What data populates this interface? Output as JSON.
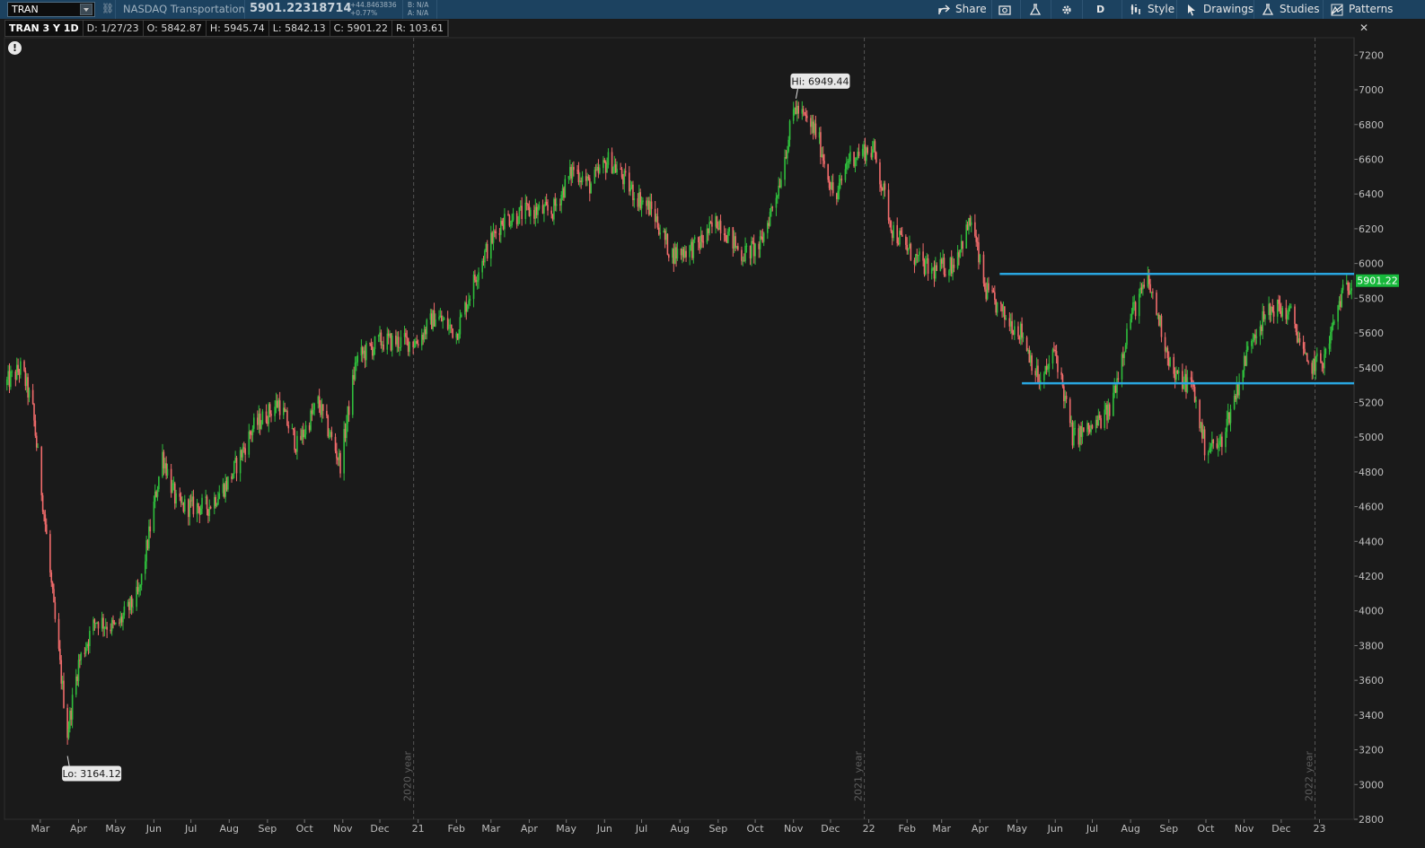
{
  "toolbar": {
    "symbol_value": "TRAN",
    "instrument_name": "NASDAQ Transportation",
    "last_price": "5901.22318714",
    "change_abs": "+44.8463836",
    "change_pct": "+0.77%",
    "bid": "B: N/A",
    "ask": "A: N/A",
    "share_label": "Share",
    "aggregation_label": "D",
    "style_label": "Style",
    "drawings_label": "Drawings",
    "studies_label": "Studies",
    "patterns_label": "Patterns",
    "icons": [
      "link-icon",
      "share-icon",
      "snapshot-icon",
      "flask-icon",
      "gear-icon",
      "style-icon",
      "cursor-icon",
      "studies-icon",
      "patterns-icon",
      "alert-icon"
    ]
  },
  "ohlc": {
    "title": "TRAN 3 Y 1D",
    "date": "D: 1/27/23",
    "open": "O: 5842.87",
    "high": "H: 5945.74",
    "low": "L: 5842.13",
    "close": "C: 5901.22",
    "range": "R: 103.61"
  },
  "colors": {
    "background": "#1a1a1a",
    "up_candle": "#2fbe3c",
    "down_candle": "#f06b6b",
    "price_line": "#29a6e0",
    "price_tag": "#17b83b",
    "toolbar": "#1c4260"
  },
  "chart_data": {
    "type": "candlestick",
    "symbol": "TRAN",
    "timeframe": "3 Y 1D",
    "ylim": [
      2800,
      7300
    ],
    "y_ticks": [
      2800,
      3000,
      3200,
      3400,
      3600,
      3800,
      4000,
      4200,
      4400,
      4600,
      4800,
      5000,
      5200,
      5400,
      5600,
      5800,
      6000,
      6200,
      6400,
      6600,
      6800,
      7000,
      7200
    ],
    "x_ticks": [
      "Mar",
      "Apr",
      "May",
      "Jun",
      "Jul",
      "Aug",
      "Sep",
      "Oct",
      "Nov",
      "Dec",
      "21",
      "Feb",
      "Mar",
      "Apr",
      "May",
      "Jun",
      "Jul",
      "Aug",
      "Sep",
      "Oct",
      "Nov",
      "Dec",
      "22",
      "Feb",
      "Mar",
      "Apr",
      "May",
      "Jun",
      "Jul",
      "Aug",
      "Sep",
      "Oct",
      "Nov",
      "Dec",
      "23"
    ],
    "year_separators": [
      "2020 year",
      "2021 year",
      "2022 year"
    ],
    "trend": [
      [
        "2020-02-01",
        5300
      ],
      [
        "2020-02-15",
        5400
      ],
      [
        "2020-02-24",
        5150
      ],
      [
        "2020-03-05",
        4500
      ],
      [
        "2020-03-12",
        4000
      ],
      [
        "2020-03-23",
        3300
      ],
      [
        "2020-04-01",
        3700
      ],
      [
        "2020-04-15",
        3950
      ],
      [
        "2020-05-01",
        3900
      ],
      [
        "2020-05-20",
        4100
      ],
      [
        "2020-06-08",
        4900
      ],
      [
        "2020-06-20",
        4600
      ],
      [
        "2020-07-15",
        4600
      ],
      [
        "2020-08-01",
        4750
      ],
      [
        "2020-08-20",
        5050
      ],
      [
        "2020-09-10",
        5200
      ],
      [
        "2020-09-25",
        4950
      ],
      [
        "2020-10-12",
        5200
      ],
      [
        "2020-10-30",
        4850
      ],
      [
        "2020-11-12",
        5450
      ],
      [
        "2020-12-01",
        5550
      ],
      [
        "2020-12-31",
        5550
      ],
      [
        "2021-01-15",
        5700
      ],
      [
        "2021-02-01",
        5600
      ],
      [
        "2021-02-20",
        6000
      ],
      [
        "2021-03-10",
        6250
      ],
      [
        "2021-04-01",
        6300
      ],
      [
        "2021-04-20",
        6300
      ],
      [
        "2021-05-07",
        6550
      ],
      [
        "2021-05-20",
        6450
      ],
      [
        "2021-06-05",
        6600
      ],
      [
        "2021-06-25",
        6400
      ],
      [
        "2021-07-10",
        6300
      ],
      [
        "2021-07-25",
        6050
      ],
      [
        "2021-08-15",
        6100
      ],
      [
        "2021-09-01",
        6250
      ],
      [
        "2021-09-20",
        6050
      ],
      [
        "2021-10-05",
        6100
      ],
      [
        "2021-10-20",
        6450
      ],
      [
        "2021-11-02",
        6900
      ],
      [
        "2021-11-20",
        6750
      ],
      [
        "2021-12-05",
        6350
      ],
      [
        "2021-12-15",
        6600
      ],
      [
        "2021-12-28",
        6650
      ],
      [
        "2022-01-05",
        6650
      ],
      [
        "2022-01-20",
        6200
      ],
      [
        "2022-02-05",
        6050
      ],
      [
        "2022-02-20",
        5950
      ],
      [
        "2022-03-10",
        6000
      ],
      [
        "2022-03-25",
        6250
      ],
      [
        "2022-04-05",
        5850
      ],
      [
        "2022-04-20",
        5700
      ],
      [
        "2022-05-05",
        5600
      ],
      [
        "2022-05-20",
        5300
      ],
      [
        "2022-06-01",
        5500
      ],
      [
        "2022-06-15",
        5000
      ],
      [
        "2022-07-01",
        5050
      ],
      [
        "2022-07-15",
        5150
      ],
      [
        "2022-08-01",
        5700
      ],
      [
        "2022-08-15",
        5900
      ],
      [
        "2022-08-25",
        5650
      ],
      [
        "2022-09-05",
        5350
      ],
      [
        "2022-09-20",
        5300
      ],
      [
        "2022-09-30",
        4950
      ],
      [
        "2022-10-12",
        4950
      ],
      [
        "2022-10-25",
        5250
      ],
      [
        "2022-11-08",
        5600
      ],
      [
        "2022-11-25",
        5750
      ],
      [
        "2022-12-10",
        5700
      ],
      [
        "2022-12-22",
        5400
      ],
      [
        "2023-01-05",
        5450
      ],
      [
        "2023-01-18",
        5800
      ],
      [
        "2023-01-27",
        5901.22
      ]
    ],
    "annotations": [
      {
        "label": "Hi: 6949.44",
        "date": "2021-11-03",
        "value": 6949.44
      },
      {
        "label": "Lo: 3164.12",
        "date": "2020-03-23",
        "value": 3164.12
      }
    ],
    "horizontal_lines": [
      {
        "value": 5940,
        "from": "2022-04-17",
        "to": "2023-01-27",
        "color": "#29a6e0"
      },
      {
        "value": 5310,
        "from": "2022-05-05",
        "to": "2023-01-27",
        "color": "#29a6e0"
      }
    ],
    "last_price_tag": "5901.22"
  }
}
